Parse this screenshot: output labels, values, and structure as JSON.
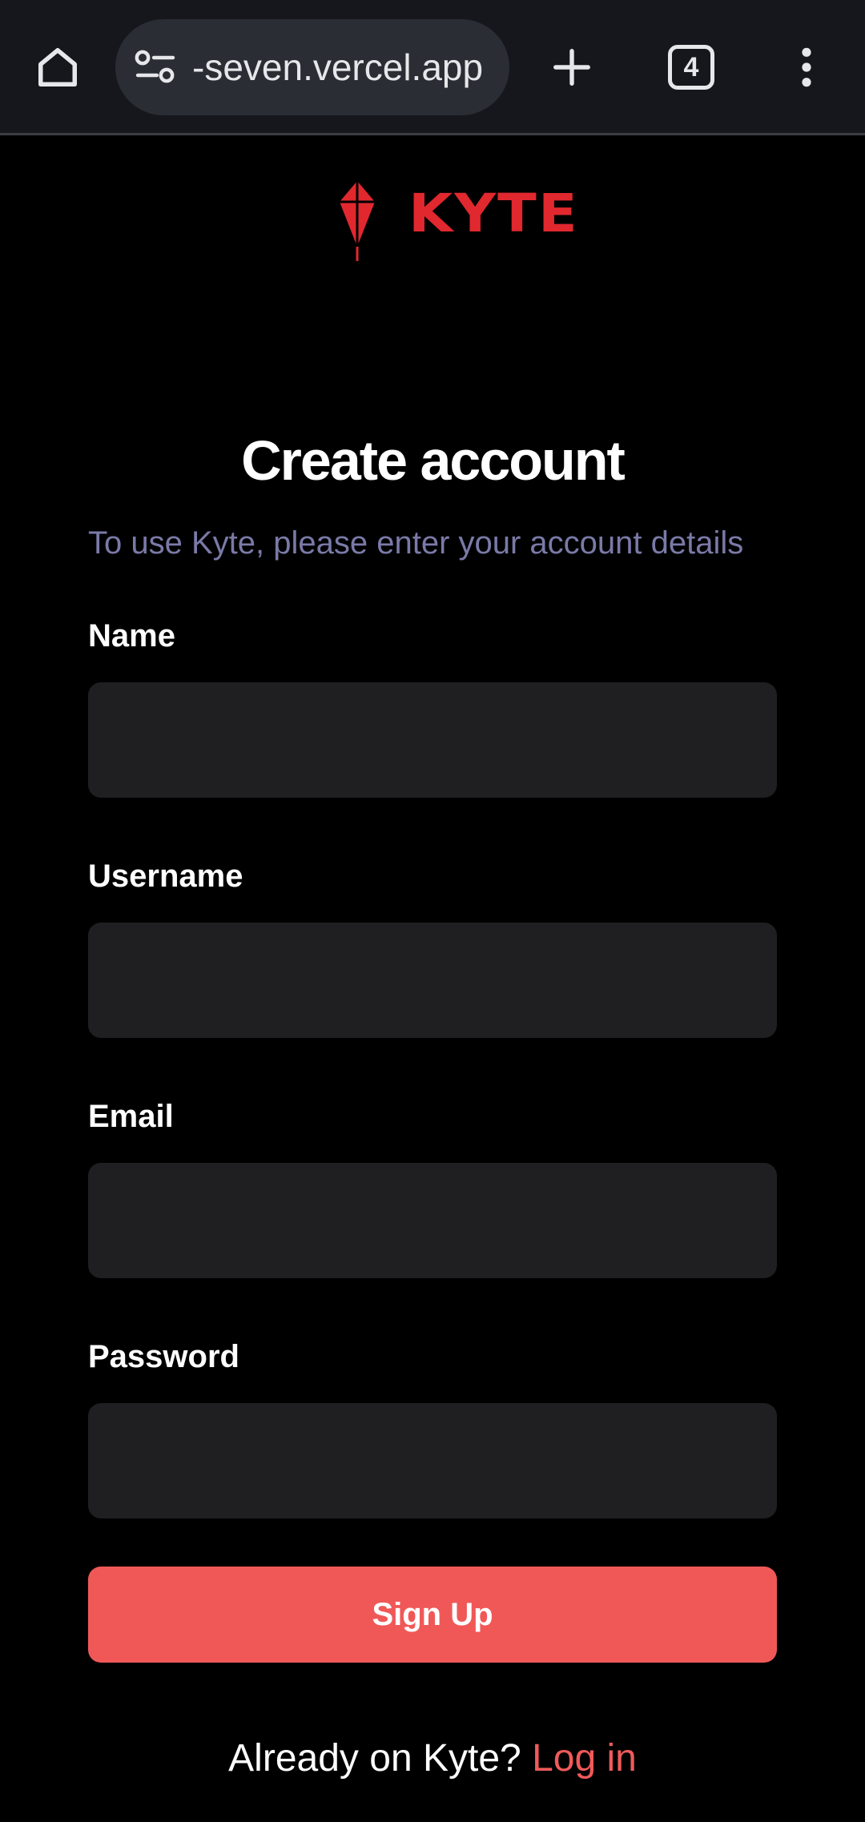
{
  "browser": {
    "url": "-seven.vercel.app",
    "tab_count": "4",
    "icons": {
      "home": "home-icon",
      "site_settings": "site-settings-icon",
      "new_tab": "plus-icon",
      "tabs": "tab-switcher-icon",
      "menu": "more-vert-icon"
    },
    "colors": {
      "toolbar_bg": "#15171c",
      "pill_bg": "#2a2d34"
    }
  },
  "brand": {
    "name": "KYTE",
    "logo_icon": "kite-icon",
    "color": "#e0282e"
  },
  "form": {
    "title": "Create account",
    "subtitle": "To use Kyte, please enter your account details",
    "fields": [
      {
        "label": "Name",
        "value": "",
        "placeholder": ""
      },
      {
        "label": "Username",
        "value": "",
        "placeholder": ""
      },
      {
        "label": "Email",
        "value": "",
        "placeholder": ""
      },
      {
        "label": "Password",
        "value": "",
        "placeholder": ""
      }
    ],
    "submit_label": "Sign Up",
    "footer_prompt": "Already on Kyte?",
    "login_label": "Log in",
    "colors": {
      "accent": "#f05858",
      "subtitle": "#7a7aa8",
      "input_bg": "#1f1f22"
    }
  }
}
